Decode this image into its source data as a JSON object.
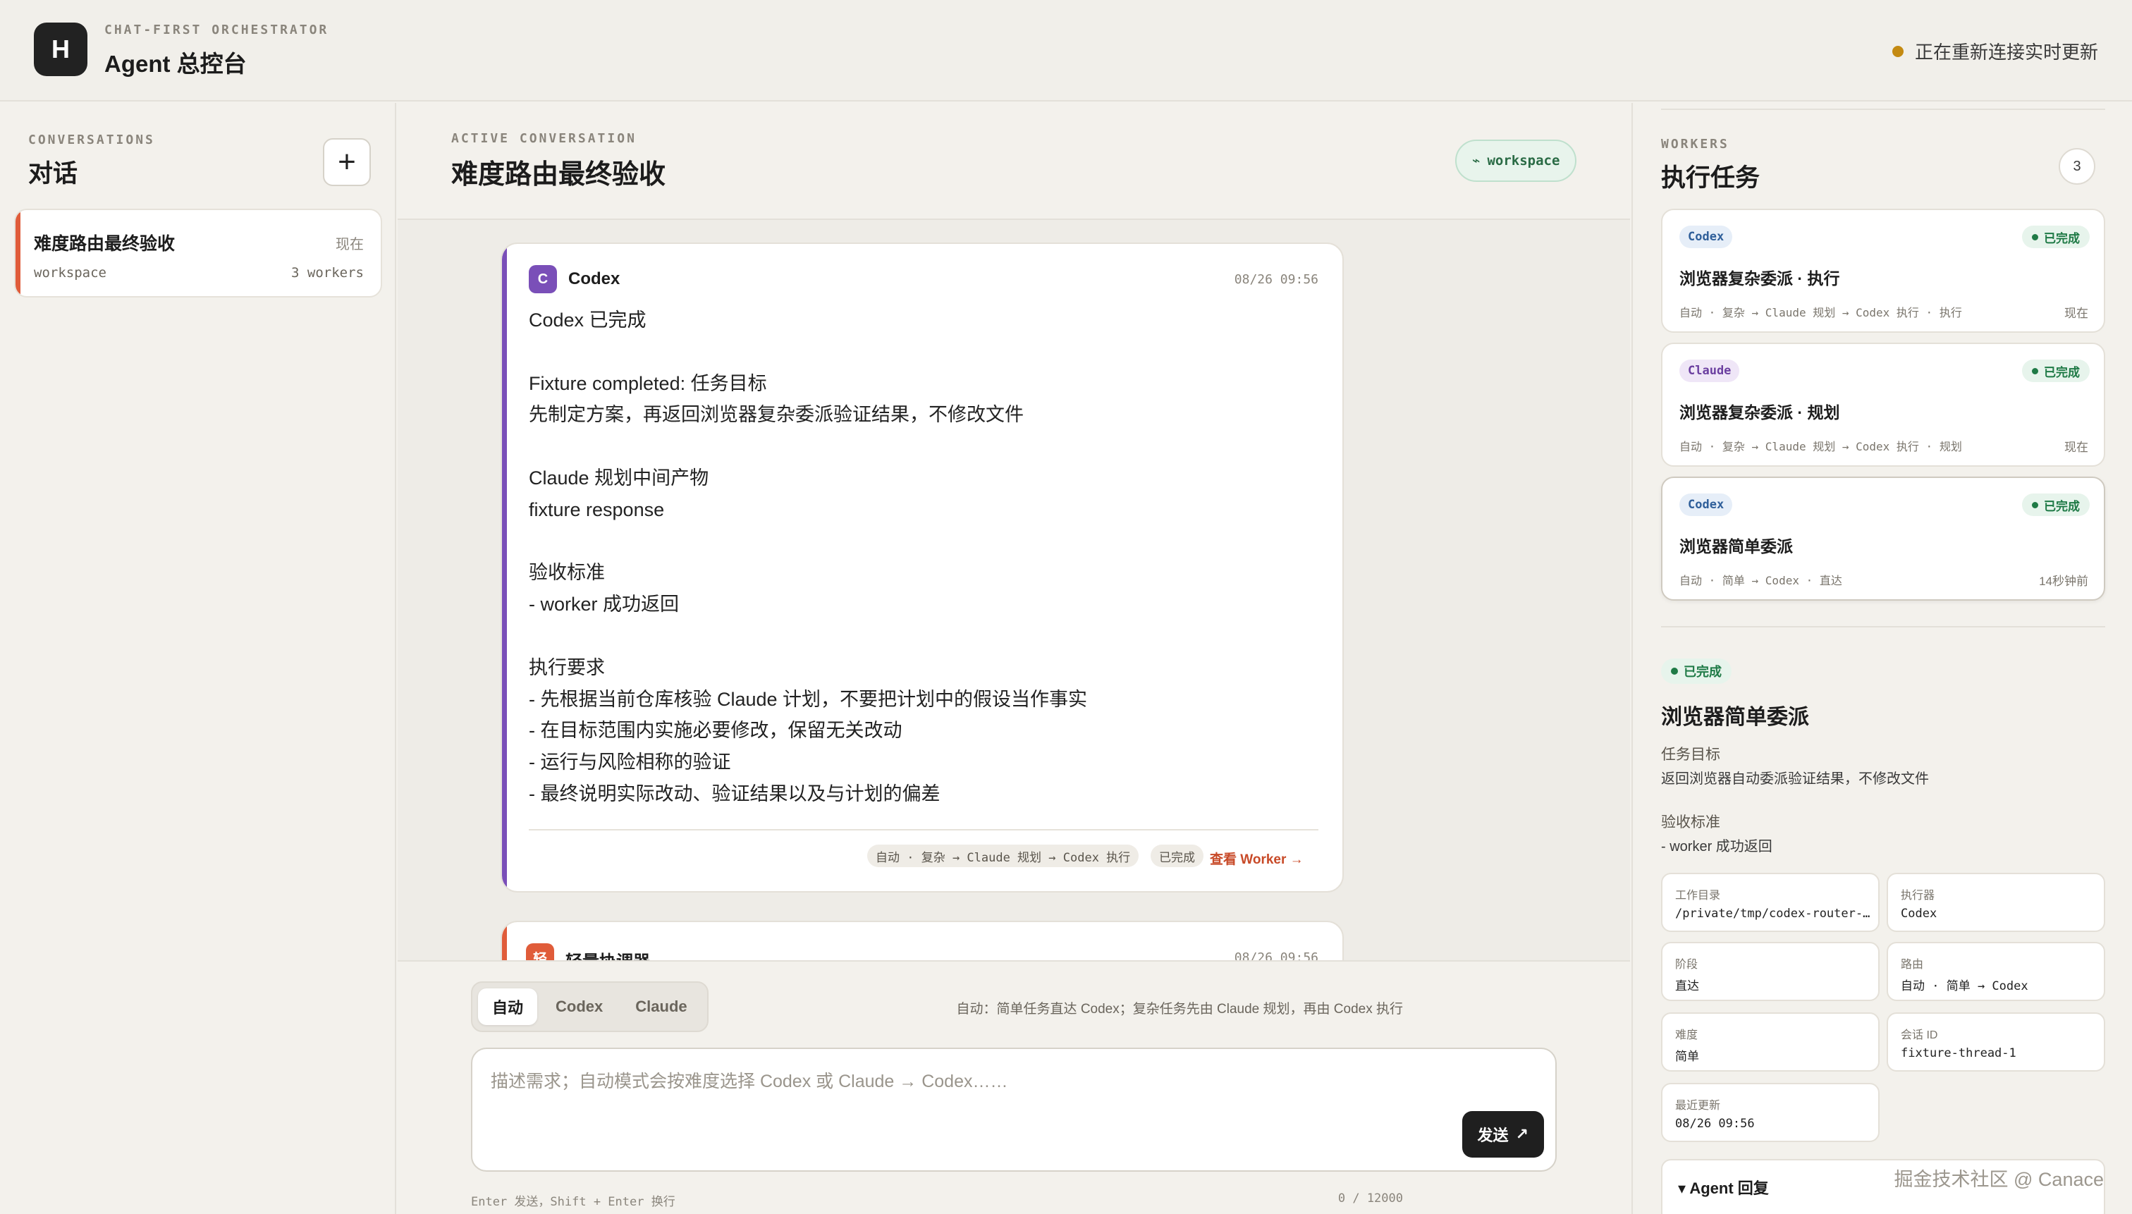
{
  "header": {
    "logo_letter": "H",
    "subtitle": "CHAT-FIRST ORCHESTRATOR",
    "title": "Agent 总控台",
    "connection_status": "正在重新连接实时更新",
    "status_color": "#c48a12"
  },
  "conversations": {
    "label": "CONVERSATIONS",
    "title": "对话",
    "add_icon": "plus-icon",
    "items": [
      {
        "title": "难度路由最终验收",
        "time": "现在",
        "workspace": "workspace",
        "workers": "3 workers"
      }
    ]
  },
  "active": {
    "label": "ACTIVE CONVERSATION",
    "title": "难度路由最终验收",
    "workspace_pill": "workspace",
    "workspace_icon": "branch-icon"
  },
  "messages": [
    {
      "avatar": "C",
      "sender": "Codex",
      "time": "08/26 09:56",
      "accent": "#7a4fb8",
      "body": "Codex 已完成\n\nFixture completed: 任务目标\n先制定方案，再返回浏览器复杂委派验证结果，不修改文件\n\nClaude 规划中间产物\nfixture response\n\n验收标准\n- worker 成功返回\n\n执行要求\n- 先根据当前仓库核验 Claude 计划，不要把计划中的假设当作事实\n- 在目标范围内实施必要修改，保留无关改动\n- 运行与风险相称的验证\n- 最终说明实际改动、验证结果以及与计划的偏差",
      "route": "自动 · 复杂 → Claude 规划 → Codex 执行",
      "status": "已完成",
      "link": "查看 Worker →"
    },
    {
      "avatar": "轻",
      "sender": "轻量协调器",
      "time": "08/26 09:56"
    }
  ],
  "composer": {
    "modes": [
      "自动",
      "Codex",
      "Claude"
    ],
    "active_mode": "自动",
    "hint": "自动：简单任务直达 Codex；复杂任务先由 Claude 规划，再由 Codex 执行",
    "placeholder": "描述需求；自动模式会按难度选择 Codex 或 Claude → Codex……",
    "value": "",
    "send_label": "发送",
    "send_icon": "arrow-up-right-icon",
    "footer_hint": "Enter 发送，Shift + Enter 换行",
    "char_count": "0 / 12000"
  },
  "workers": {
    "label": "WORKERS",
    "title": "执行任务",
    "count": "3",
    "tasks": [
      {
        "tag": "Codex",
        "status": "已完成",
        "title": "浏览器复杂委派 · 执行",
        "route": "自动 · 复杂 → Claude 规划 → Codex 执行 · 执行",
        "time": "现在"
      },
      {
        "tag": "Claude",
        "status": "已完成",
        "title": "浏览器复杂委派 · 规划",
        "route": "自动 · 复杂 → Claude 规划 → Codex 执行 · 规划",
        "time": "现在"
      },
      {
        "tag": "Codex",
        "status": "已完成",
        "title": "浏览器简单委派",
        "route": "自动 · 简单 → Codex · 直达",
        "time": "14秒钟前"
      }
    ]
  },
  "detail": {
    "status": "已完成",
    "title": "浏览器简单委派",
    "goal_label": "任务目标",
    "goal": "返回浏览器自动委派验证结果，不修改文件",
    "criteria_label": "验收标准",
    "criteria": "- worker 成功返回",
    "fields": [
      {
        "k": "工作目录",
        "v": "/private/tmp/codex-router-v…"
      },
      {
        "k": "执行器",
        "v": "Codex"
      },
      {
        "k": "阶段",
        "v": "直达"
      },
      {
        "k": "路由",
        "v": "自动 · 简单 → Codex"
      },
      {
        "k": "难度",
        "v": "简单"
      },
      {
        "k": "会话 ID",
        "v": "fixture-thread-1"
      },
      {
        "k": "最近更新",
        "v": "08/26 09:56"
      }
    ],
    "reply_toggle": "▾ Agent 回复"
  },
  "watermark": "掘金技术社区 @ Canace"
}
